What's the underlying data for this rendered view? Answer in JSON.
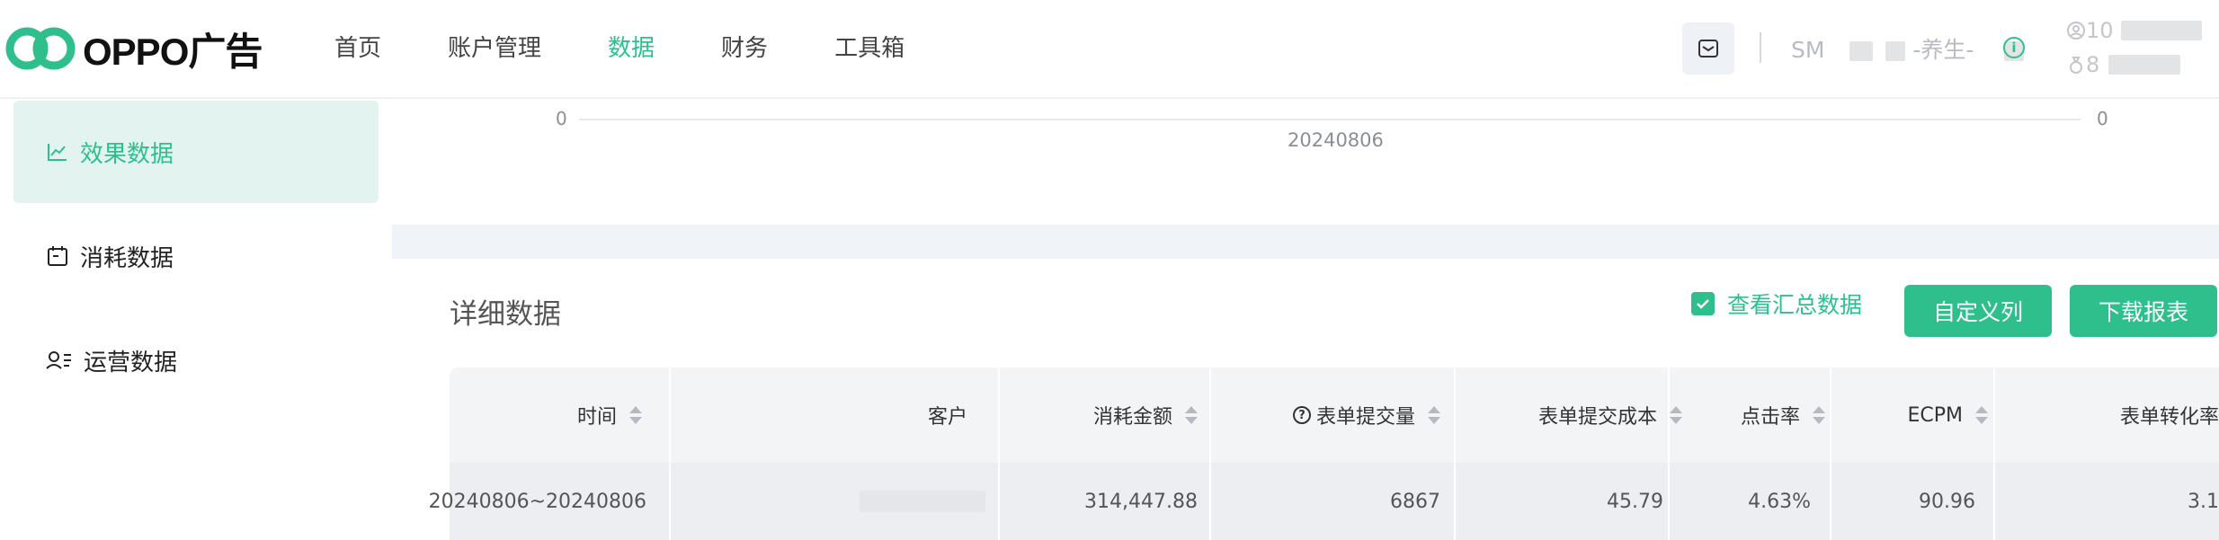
{
  "brand": {
    "logo_text": "OPPO广告",
    "accent": "#2fbf8d"
  },
  "nav": [
    {
      "label": "首页",
      "active": false
    },
    {
      "label": "账户管理",
      "active": false
    },
    {
      "label": "数据",
      "active": true
    },
    {
      "label": "财务",
      "active": false
    },
    {
      "label": "工具箱",
      "active": false
    }
  ],
  "account": {
    "prefix": "SM",
    "middle": "-养生-"
  },
  "account_meta": {
    "id_prefix": "10",
    "balance_prefix": "8"
  },
  "sidebar": [
    {
      "label": "效果数据",
      "icon": "line-chart-icon",
      "active": true
    },
    {
      "label": "消耗数据",
      "icon": "calendar-icon",
      "active": false
    },
    {
      "label": "运营数据",
      "icon": "user-list-icon",
      "active": false
    }
  ],
  "chart": {
    "y_left_zero": "0",
    "y_right_zero": "0",
    "x_tick": "20240806"
  },
  "detail": {
    "title": "详细数据",
    "summary_toggle": "查看汇总数据",
    "summary_checked": true,
    "custom_columns": "自定义列",
    "download": "下载报表"
  },
  "table": {
    "columns": [
      "时间",
      "客户",
      "消耗金额",
      "表单提交量",
      "表单提交成本",
      "点击率",
      "ECPM",
      "表单转化率"
    ],
    "rows": [
      [
        "20240806~20240806",
        "",
        "314,447.88",
        "6867",
        "45.79",
        "4.63%",
        "90.96",
        "3.1"
      ]
    ]
  }
}
